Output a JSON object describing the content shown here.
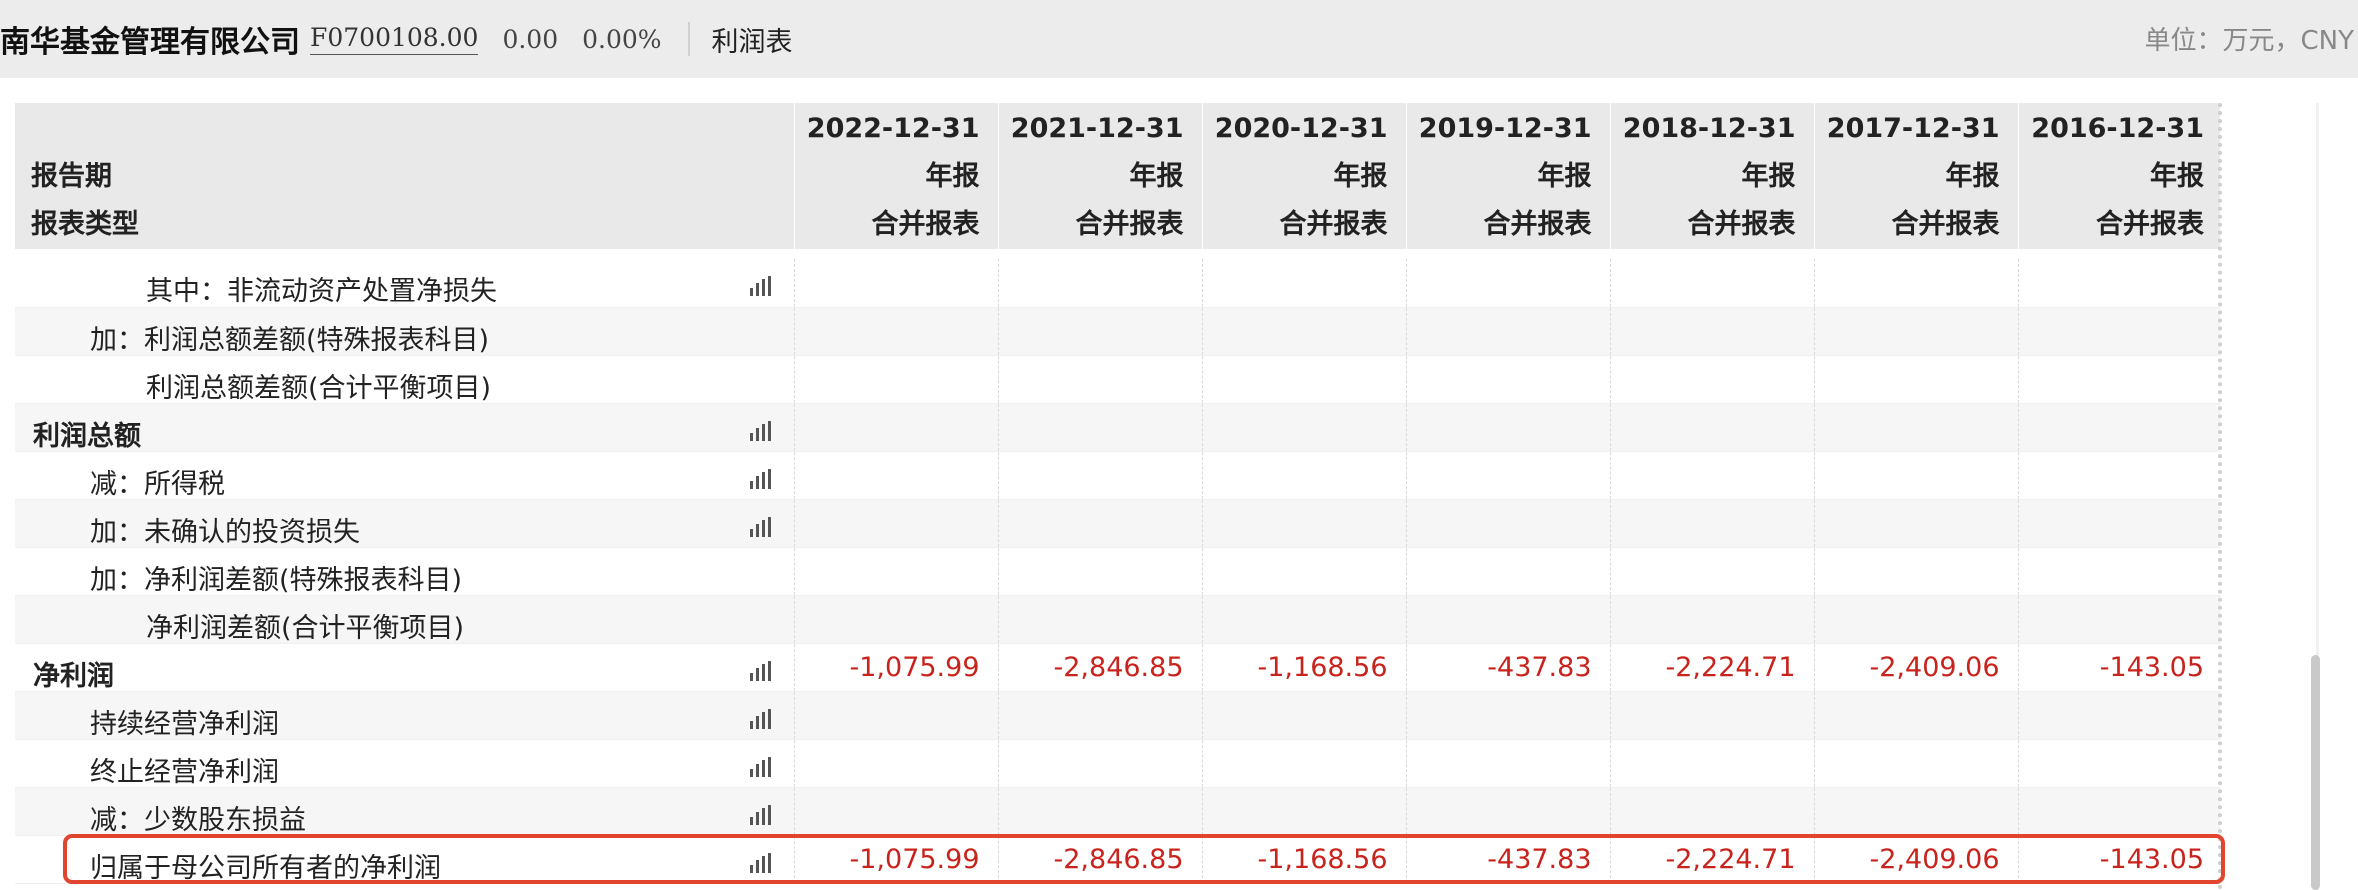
{
  "header": {
    "company_name": "南华基金管理有限公司",
    "code": "F0700108.00",
    "price": "0.00",
    "change_pct": "0.00%",
    "report_type": "利润表",
    "unit": "单位：万元，CNY"
  },
  "table": {
    "header_labels": {
      "period": "报告期",
      "type": "报表类型"
    },
    "columns": [
      {
        "date": "2022-12-31",
        "period": "年报",
        "type": "合并报表"
      },
      {
        "date": "2021-12-31",
        "period": "年报",
        "type": "合并报表"
      },
      {
        "date": "2020-12-31",
        "period": "年报",
        "type": "合并报表"
      },
      {
        "date": "2019-12-31",
        "period": "年报",
        "type": "合并报表"
      },
      {
        "date": "2018-12-31",
        "period": "年报",
        "type": "合并报表"
      },
      {
        "date": "2017-12-31",
        "period": "年报",
        "type": "合并报表"
      },
      {
        "date": "2016-12-31",
        "period": "年报",
        "type": "合并报表"
      }
    ],
    "rows": [
      {
        "label": "其中：非流动资产处置净损失",
        "values": [
          "",
          "",
          "",
          "",
          "",
          "",
          ""
        ]
      },
      {
        "label": "加：利润总额差额(特殊报表科目)",
        "values": [
          "",
          "",
          "",
          "",
          "",
          "",
          ""
        ]
      },
      {
        "label": "利润总额差额(合计平衡项目)",
        "values": [
          "",
          "",
          "",
          "",
          "",
          "",
          ""
        ]
      },
      {
        "label": "利润总额",
        "values": [
          "",
          "",
          "",
          "",
          "",
          "",
          ""
        ]
      },
      {
        "label": "减：所得税",
        "values": [
          "",
          "",
          "",
          "",
          "",
          "",
          ""
        ]
      },
      {
        "label": "加：未确认的投资损失",
        "values": [
          "",
          "",
          "",
          "",
          "",
          "",
          ""
        ]
      },
      {
        "label": "加：净利润差额(特殊报表科目)",
        "values": [
          "",
          "",
          "",
          "",
          "",
          "",
          ""
        ]
      },
      {
        "label": "净利润差额(合计平衡项目)",
        "values": [
          "",
          "",
          "",
          "",
          "",
          "",
          ""
        ]
      },
      {
        "label": "净利润",
        "values": [
          "-1,075.99",
          "-2,846.85",
          "-1,168.56",
          "-437.83",
          "-2,224.71",
          "-2,409.06",
          "-143.05"
        ]
      },
      {
        "label": "持续经营净利润",
        "values": [
          "",
          "",
          "",
          "",
          "",
          "",
          ""
        ]
      },
      {
        "label": "终止经营净利润",
        "values": [
          "",
          "",
          "",
          "",
          "",
          "",
          ""
        ]
      },
      {
        "label": "减：少数股东损益",
        "values": [
          "",
          "",
          "",
          "",
          "",
          "",
          ""
        ]
      },
      {
        "label": "归属于母公司所有者的净利润",
        "values": [
          "-1,075.99",
          "-2,846.85",
          "-1,168.56",
          "-437.83",
          "-2,224.71",
          "-2,409.06",
          "-143.05"
        ]
      }
    ]
  },
  "colors": {
    "negative": "#c8231c",
    "highlight": "#e2452e",
    "header_bg": "#e9e9e9"
  },
  "icons": {
    "chart": "bar-chart-icon"
  }
}
